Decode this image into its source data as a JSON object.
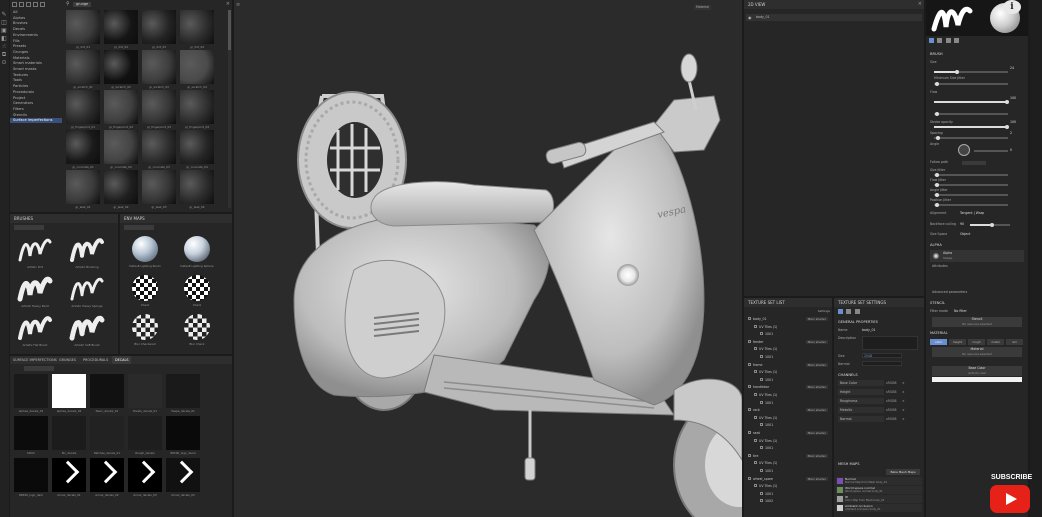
{
  "colors": {
    "bg": "#1b1b1b",
    "panel": "#262626",
    "viewport": "#2b2b2b",
    "selection": "#39507a",
    "accent_purple": "#7a4fb0",
    "youtube_red": "#e62117"
  },
  "shelf": {
    "categories": [
      "All",
      "Alphas",
      "Brushes",
      "Decals",
      "Environments",
      "Fills",
      "Presets",
      "Grunges",
      "Materials",
      "Smart materials",
      "Smart masks",
      "Textures",
      "Tools",
      "Particles",
      "Procedurals",
      "Project",
      "Generators",
      "Filters",
      "Stencils",
      "Surface imperfections"
    ],
    "selected_index": 19,
    "search_value": "grunge",
    "grunge_labels": [
      "gr_dirt_01",
      "gr_dirt_02",
      "gr_dirt_03",
      "gr_dirt_04",
      "gr_scratch_01",
      "gr_scratch_02",
      "gr_scratch_03",
      "gr_scratch_04",
      "gr_fingerprint_01",
      "gr_fingerprint_02",
      "gr_fingerprint_03",
      "gr_fingerprint_04",
      "gr_concrete_01",
      "gr_concrete_02",
      "gr_concrete_03",
      "gr_concrete_04",
      "gr_leak_01",
      "gr_leak_02",
      "gr_leak_03",
      "gr_leak_04"
    ]
  },
  "brushes_panel": {
    "title": "BRUSHES",
    "items": [
      "Artistic Dirt",
      "Artistic Brushing",
      "Artistic Heavy Paint",
      "Artistic Heavy Sponge",
      "Artistic Flat Brush",
      "Artistic Soft Brush"
    ]
  },
  "env_panel": {
    "title": "ENV MAPS",
    "items": [
      "Default Lighting Room",
      "Default Lighting Sphere",
      "Check",
      "Check",
      "Blur Checkered",
      "Blur Check"
    ]
  },
  "decals_panel": {
    "tabs": [
      "SURFACE IMPERFECTIONS",
      "GRUNGES",
      "PROCEDURALS",
      "DECALS"
    ],
    "active_tab": 3,
    "items": [
      "alphas_decals_01",
      "alphas_decals_02",
      "Neon_decals_01",
      "Rivets_decals_01",
      "Vespa_decals_01",
      "Stitch",
      "Pin_decals",
      "Patches_decals_01",
      "Rough_decals",
      "8650K_logo_decal",
      "8650K_logo_dark",
      "Arrow_decals_01",
      "Arrow_decals_02",
      "Arrow_decals_03",
      "Arrow_decals_04"
    ]
  },
  "viewport": {
    "mode_label": "Material",
    "camera_label": "3D View"
  },
  "uv_panel": {
    "title": "2D VIEW",
    "item": "body_01"
  },
  "texture_sets": {
    "title": "TEXTURE SET LIST",
    "settings_label": "Settings",
    "rows": [
      {
        "name": "body_01",
        "shader": "Main shader",
        "indent": 0
      },
      {
        "name": "UV Tiles (1)",
        "shader": "",
        "indent": 1
      },
      {
        "name": "1001",
        "shader": "",
        "indent": 2
      },
      {
        "name": "fender",
        "shader": "Main shader",
        "indent": 0
      },
      {
        "name": "UV Tiles (1)",
        "shader": "",
        "indent": 1
      },
      {
        "name": "1001",
        "shader": "",
        "indent": 2
      },
      {
        "name": "frame",
        "shader": "Main shader",
        "indent": 0
      },
      {
        "name": "UV Tiles (1)",
        "shader": "",
        "indent": 1
      },
      {
        "name": "1001",
        "shader": "",
        "indent": 2
      },
      {
        "name": "handlebar",
        "shader": "Main shader",
        "indent": 0
      },
      {
        "name": "UV Tiles (1)",
        "shader": "",
        "indent": 1
      },
      {
        "name": "1001",
        "shader": "",
        "indent": 2
      },
      {
        "name": "rack",
        "shader": "Main shader",
        "indent": 0
      },
      {
        "name": "UV Tiles (1)",
        "shader": "",
        "indent": 1
      },
      {
        "name": "1001",
        "shader": "",
        "indent": 2
      },
      {
        "name": "seat",
        "shader": "Main shader",
        "indent": 0
      },
      {
        "name": "UV Tiles (1)",
        "shader": "",
        "indent": 1
      },
      {
        "name": "1001",
        "shader": "",
        "indent": 2
      },
      {
        "name": "tire",
        "shader": "Main shader",
        "indent": 0
      },
      {
        "name": "UV Tiles (1)",
        "shader": "",
        "indent": 1
      },
      {
        "name": "1001",
        "shader": "",
        "indent": 2
      },
      {
        "name": "wheel_spare",
        "shader": "Main shader",
        "indent": 0
      },
      {
        "name": "UV Tiles (1)",
        "shader": "",
        "indent": 1
      },
      {
        "name": "1001",
        "shader": "",
        "indent": 2
      },
      {
        "name": "1002",
        "shader": "",
        "indent": 2
      }
    ]
  },
  "ts_settings": {
    "title": "TEXTURE SET SETTINGS",
    "general_title": "GENERAL PROPERTIES",
    "name_label": "Name",
    "name_value": "body_01",
    "desc_label": "Description",
    "size_label": "Size",
    "size_value": "2048",
    "normal_label": "Normal",
    "channels_title": "CHANNELS",
    "channels": [
      "Base Color",
      "Height",
      "Roughness",
      "Metallic",
      "Normal"
    ],
    "channel_format": "sRGB8",
    "bake_title": "MESH MAPS",
    "bake_button": "Bake Mesh Maps",
    "maps": [
      "Normal",
      "World space normal",
      "ID",
      "Ambient occlusion"
    ],
    "maps_sub": [
      "Normal Map from Mesh body_01",
      "World space normal body_01",
      "Color Map from Mesh body_01",
      "Ambient occlusion body_01"
    ]
  },
  "properties": {
    "brush_title": "BRUSH",
    "size_label": "Size",
    "size_value": "24",
    "min_size_label": "Minimum Size Jitter",
    "flow_label": "Flow",
    "flow_value": "100",
    "stroke_opacity_label": "Stroke opacity",
    "stroke_opacity_value": "100",
    "spacing_label": "Spacing",
    "spacing_value": "2",
    "angle_label": "Angle",
    "angle_value": "0",
    "follow_path_label": "Follow path",
    "size_jitter_label": "Size Jitter",
    "flow_jitter_label": "Flow Jitter",
    "angle_jitter_label": "Angle Jitter",
    "position_jitter_label": "Position Jitter",
    "alignment_label": "Alignment",
    "alignment_value": "Tangent | Wrap",
    "backface_label": "Backface culling",
    "backface_value": "90",
    "size_space_label": "Size Space",
    "size_space_value": "Object",
    "alpha_title": "ALPHA",
    "alpha_name": "Alpha",
    "alpha_sub": "Shape",
    "attributes_label": "Attributes",
    "advanced_label": "Advanced parameters",
    "stencil_title": "STENCIL",
    "filter_label": "Filter mode",
    "filter_value": "No filter",
    "stencil_button": "Stencil",
    "stencil_sub": "No resource selected",
    "material_title": "MATERIAL",
    "material_tabs": [
      "color",
      "height",
      "rough",
      "metal",
      "nrm"
    ],
    "material_button": "Material",
    "material_sub": "No resource selected",
    "base_color_label": "Base Color",
    "base_color_sub": "uniform color"
  },
  "subscribe": {
    "label": "SUBSCRIBE"
  }
}
